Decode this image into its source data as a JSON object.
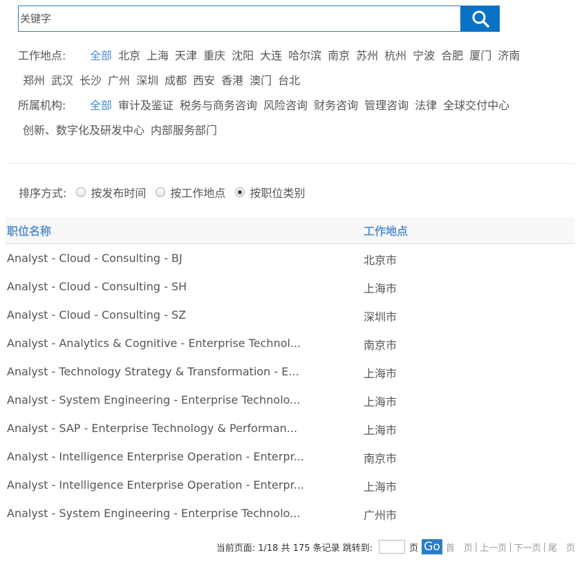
{
  "search": {
    "placeholder": "关键字"
  },
  "location_filter": {
    "label": "工作地点:",
    "options": [
      "全部",
      "北京",
      "上海",
      "天津",
      "重庆",
      "沈阳",
      "大连",
      "哈尔滨",
      "南京",
      "苏州",
      "杭州",
      "宁波",
      "合肥",
      "厦门",
      "济南",
      "郑州",
      "武汉",
      "长沙",
      "广州",
      "深圳",
      "成都",
      "西安",
      "香港",
      "澳门",
      "台北"
    ]
  },
  "org_filter": {
    "label": "所属机构:",
    "options": [
      "全部",
      "审计及鉴证",
      "税务与商务咨询",
      "风险咨询",
      "财务咨询",
      "管理咨询",
      "法律",
      "全球交付中心",
      "创新、数字化及研发中心",
      "内部服务部门"
    ]
  },
  "sort": {
    "label": "排序方式:",
    "options": [
      "按发布时间",
      "按工作地点",
      "按职位类别"
    ],
    "selected": 2
  },
  "table": {
    "headers": {
      "name": "职位名称",
      "location": "工作地点"
    },
    "rows": [
      {
        "name": "Analyst - Cloud - Consulting - BJ",
        "location": "北京市"
      },
      {
        "name": "Analyst - Cloud - Consulting - SH",
        "location": "上海市"
      },
      {
        "name": "Analyst - Cloud - Consulting - SZ",
        "location": "深圳市"
      },
      {
        "name": "Analyst - Analytics & Cognitive - Enterprise Technol...",
        "location": "南京市"
      },
      {
        "name": "Analyst - Technology Strategy & Transformation - E...",
        "location": "上海市"
      },
      {
        "name": "Analyst - System Engineering - Enterprise Technolo...",
        "location": "上海市"
      },
      {
        "name": "Analyst - SAP - Enterprise Technology & Performan...",
        "location": "上海市"
      },
      {
        "name": "Analyst - Intelligence Enterprise Operation - Enterpr...",
        "location": "南京市"
      },
      {
        "name": "Analyst - Intelligence Enterprise Operation - Enterpr...",
        "location": "上海市"
      },
      {
        "name": "Analyst - System Engineering - Enterprise Technolo...",
        "location": "广州市"
      }
    ]
  },
  "pager": {
    "info": "当前页面: 1/18  共 175 条记录 跳转到:",
    "page_unit": "页",
    "go": "Go",
    "first": "首　页",
    "prev": "上一页",
    "next": "下一页",
    "last": "尾　页",
    "sep": "|"
  },
  "colors": {
    "accent": "#0a72c5",
    "active_link": "#4a8fd0",
    "header_text": "#5b93cf"
  }
}
